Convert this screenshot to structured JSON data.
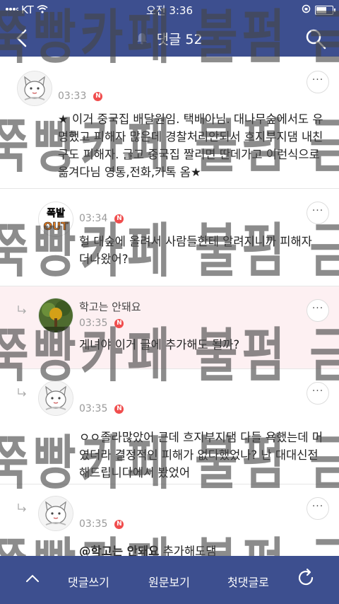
{
  "status": {
    "carrier": "KT",
    "time": "오전 3:36"
  },
  "header": {
    "title": "댓글 52"
  },
  "comments": [
    {
      "nickname": "",
      "time": "03:33",
      "badge": "N",
      "text": "★ 이거 중국집 배달원임. 택배아님. 대나무숲에서도 유명했고 피해자 많은데 경찰처리안되서 흐지부지댐 내친구도 피해자. 글고 중국집 짤리면 딴데가고 이런식으로 옮겨다님 영통,전화,카톡 옴★",
      "avatar": "cat-sketch-avatar"
    },
    {
      "nickname": "",
      "time": "03:34",
      "badge": "N",
      "text": "헐 대숲에 올려서 사람들한테 알려지니까 피해자 더나왔어?",
      "avatar_label_top": "폭발",
      "avatar_label_bottom": "OUT"
    },
    {
      "nickname": "학고는 안돼요",
      "time": "03:35",
      "badge": "N",
      "text": "게녀야 이거 글에 추가해도 될까?",
      "avatar": "tree-photo-avatar"
    },
    {
      "nickname": "",
      "time": "03:35",
      "badge": "N",
      "text": "ㅇㅇ졸라많았어 근데 흐지부지댐 다들 욕했는데 머였더라 결정적인 피해가 없다했었나? 난 대대신전해드립니다에서 봤었어",
      "avatar": "cat-sketch-avatar"
    },
    {
      "nickname": "",
      "time": "03:35",
      "badge": "N",
      "mention": "@학고는 안돼요",
      "text": "추가해도댐",
      "avatar": "cat-sketch-avatar"
    }
  ],
  "watermark": "쭉빵카페 불펌 금지",
  "bottom": {
    "write": "댓글쓰기",
    "original": "원문보기",
    "first": "첫댓글로"
  }
}
